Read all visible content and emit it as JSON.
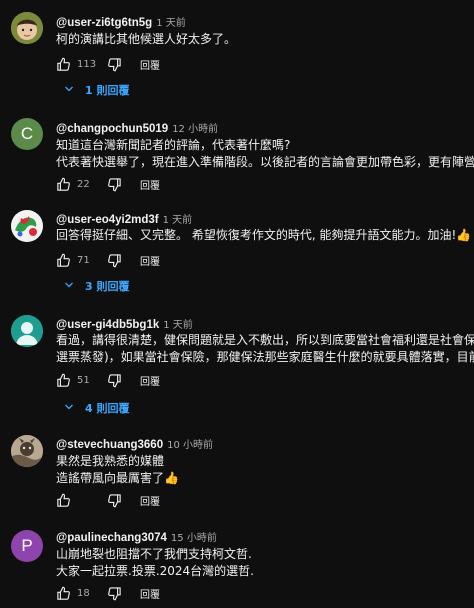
{
  "comments": [
    {
      "user": "@user-zi6tg6tn5g",
      "time": "1 天前",
      "lines": [
        "柯的演講比其他候選人好太多了。"
      ],
      "likes": "113",
      "reply_label": "回覆",
      "replies_label": "1 則回覆",
      "avatar": {
        "type": "photo",
        "color": "#8a9a3a"
      }
    },
    {
      "user": "@changpochun5019",
      "time": "12 小時前",
      "lines": [
        "知道這台灣新聞記者的評論，代表著什麼嗎?",
        "代表著快選舉了，現在進入準備階段。以後記者的言論會更加帶色彩，更有陣營意識"
      ],
      "likes": "22",
      "reply_label": "回覆",
      "avatar": {
        "type": "letter",
        "letter": "C",
        "color": "#5c8a4a"
      }
    },
    {
      "user": "@user-eo4yi2md3f",
      "time": "1 天前",
      "lines": [
        "回答得挺仔細、又完整。 希望恢復考作文的時代, 能夠提升語文能力。加油!👍"
      ],
      "likes": "71",
      "reply_label": "回覆",
      "replies_label": "3 則回覆",
      "avatar": {
        "type": "pattern",
        "color": "#2e9c4a"
      }
    },
    {
      "user": "@user-gi4db5bg1k",
      "time": "1 天前",
      "lines": [
        "看過，講得很清楚，健保問題就是入不敷出，所以到底要當社會福利還是社會保險，",
        "選票蒸發)，如果當社會保險，那健保法那些家庭醫生什麼的就要具體落實，目前法令"
      ],
      "likes": "51",
      "reply_label": "回覆",
      "replies_label": "4 則回覆",
      "avatar": {
        "type": "person",
        "color": "#1e9e90"
      }
    },
    {
      "user": "@stevechuang3660",
      "time": "10 小時前",
      "lines": [
        "果然是我熟悉的媒體",
        "造謠帶風向最厲害了👍"
      ],
      "likes": "",
      "reply_label": "回覆",
      "avatar": {
        "type": "photo2",
        "color": "#8a7a6a"
      }
    },
    {
      "user": "@paulinechang3074",
      "time": "15 小時前",
      "lines": [
        "山崩地裂也阻擋不了我們支持柯文哲.",
        "大家一起拉票.投票.2024台灣的選哲."
      ],
      "likes": "18",
      "reply_label": "回覆",
      "avatar": {
        "type": "letter",
        "letter": "P",
        "color": "#8e44ad"
      }
    }
  ],
  "icons": {
    "like": "thumbs-up-icon",
    "dislike": "thumbs-down-icon",
    "expand": "chevron-down-icon"
  },
  "colors": {
    "background": "#0f0f0f",
    "link": "#3ea6ff",
    "muted": "#aaaaaa"
  }
}
